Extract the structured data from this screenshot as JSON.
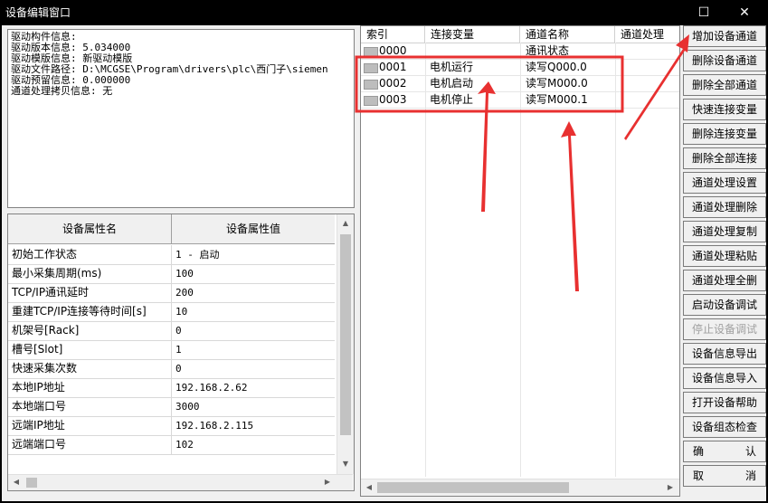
{
  "window": {
    "title": "设备编辑窗口",
    "maximize_glyph": "☐",
    "close_glyph": "✕"
  },
  "info_box": {
    "lines": [
      "驱动构件信息:",
      "驱动版本信息: 5.034000",
      "驱动模版信息: 新驱动模版",
      "驱动文件路径: D:\\MCGSE\\Program\\drivers\\plc\\西门子\\siemen",
      "驱动预留信息: 0.000000",
      "通道处理拷贝信息: 无"
    ]
  },
  "property_grid": {
    "col_name": "设备属性名",
    "col_value": "设备属性值",
    "rows": [
      {
        "name": "初始工作状态",
        "value": "1 - 启动"
      },
      {
        "name": "最小采集周期(ms)",
        "value": "100"
      },
      {
        "name": "TCP/IP通讯延时",
        "value": "200"
      },
      {
        "name": "重建TCP/IP连接等待时间[s]",
        "value": "10"
      },
      {
        "name": "机架号[Rack]",
        "value": "0"
      },
      {
        "name": "槽号[Slot]",
        "value": "1"
      },
      {
        "name": "快速采集次数",
        "value": "0"
      },
      {
        "name": "本地IP地址",
        "value": "192.168.2.62"
      },
      {
        "name": "本地端口号",
        "value": "3000"
      },
      {
        "name": "远端IP地址",
        "value": "192.168.2.115"
      },
      {
        "name": "远端端口号",
        "value": "102"
      }
    ]
  },
  "channel_list": {
    "headers": [
      "索引",
      "连接变量",
      "通道名称",
      "通道处理"
    ],
    "rows": [
      {
        "index": "0000",
        "variable": "",
        "channel": "通讯状态",
        "process": ""
      },
      {
        "index": "0001",
        "variable": "电机运行",
        "channel": "读写Q000.0",
        "process": ""
      },
      {
        "index": "0002",
        "variable": "电机启动",
        "channel": "读写M000.0",
        "process": ""
      },
      {
        "index": "0003",
        "variable": "电机停止",
        "channel": "读写M000.1",
        "process": ""
      }
    ]
  },
  "buttons": {
    "add_channel": "增加设备通道",
    "delete_channel": "删除设备通道",
    "delete_all_channels": "删除全部通道",
    "quick_connect": "快速连接变量",
    "delete_connection": "删除连接变量",
    "delete_all_connections": "删除全部连接",
    "channel_process_settings": "通道处理设置",
    "channel_process_delete": "通道处理删除",
    "channel_process_copy": "通道处理复制",
    "channel_process_paste": "通道处理粘贴",
    "channel_process_delete_all": "通道处理全删",
    "start_debug": "启动设备调试",
    "stop_debug": "停止设备调试",
    "export_info": "设备信息导出",
    "import_info": "设备信息导入",
    "open_help": "打开设备帮助",
    "config_check": "设备组态检查",
    "confirm_left": "确",
    "confirm_right": "认",
    "cancel_left": "取",
    "cancel_right": "消"
  },
  "colors": {
    "annotation": "#e83030"
  }
}
